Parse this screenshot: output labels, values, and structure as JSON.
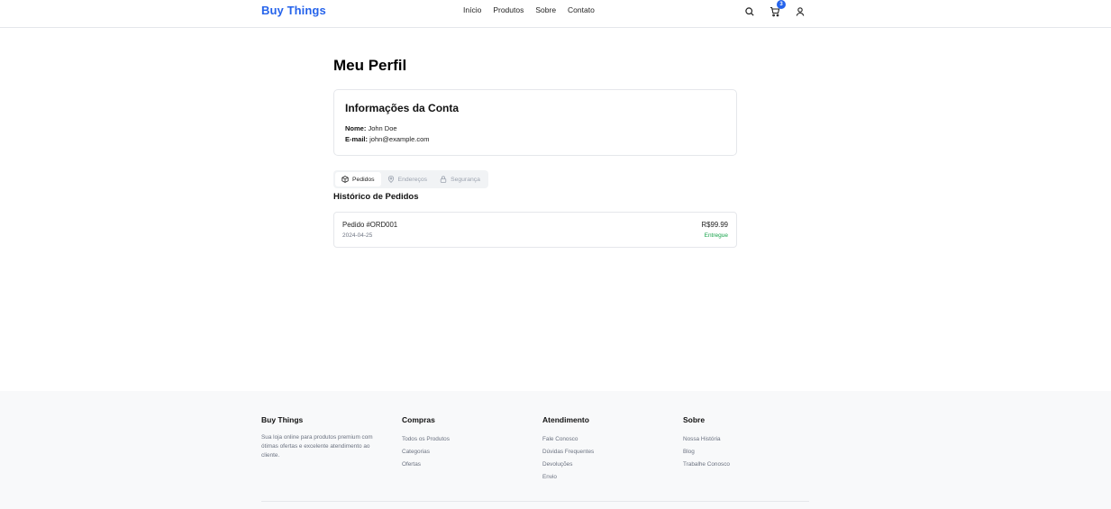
{
  "header": {
    "brand": "Buy Things",
    "nav": [
      "Início",
      "Produtos",
      "Sobre",
      "Contato"
    ],
    "cart_count": "3",
    "icons": [
      "search-icon",
      "cart-icon",
      "user-icon"
    ]
  },
  "main": {
    "title": "Meu Perfil",
    "account": {
      "title": "Informações da Conta",
      "name_label": "Nome:",
      "name_value": "John Doe",
      "email_label": "E-mail:",
      "email_value": "john@example.com"
    },
    "tabs": [
      {
        "label": "Pedidos",
        "icon": "package-icon",
        "active": true
      },
      {
        "label": "Endereços",
        "icon": "map-pin-icon",
        "active": false
      },
      {
        "label": "Segurança",
        "icon": "lock-icon",
        "active": false
      }
    ],
    "orders_title": "Histórico de Pedidos",
    "orders": [
      {
        "id": "Pedido #ORD001",
        "date": "2024-04-25",
        "price": "R$99.99",
        "status": "Entregue"
      }
    ]
  },
  "footer": {
    "about": {
      "title": "Buy Things",
      "text": "Sua loja online para produtos premium com ótimas ofertas e excelente atendimento ao cliente."
    },
    "columns": [
      {
        "title": "Compras",
        "links": [
          "Todos os Produtos",
          "Categorias",
          "Ofertas"
        ]
      },
      {
        "title": "Atendimento",
        "links": [
          "Fale Conosco",
          "Dúvidas Frequentes",
          "Devoluções",
          "Envio"
        ]
      },
      {
        "title": "Sobre",
        "links": [
          "Nossa História",
          "Blog",
          "Trabalhe Conosco"
        ]
      }
    ]
  },
  "colors": {
    "brand": "#2563eb",
    "status_delivered": "#16a34a"
  }
}
